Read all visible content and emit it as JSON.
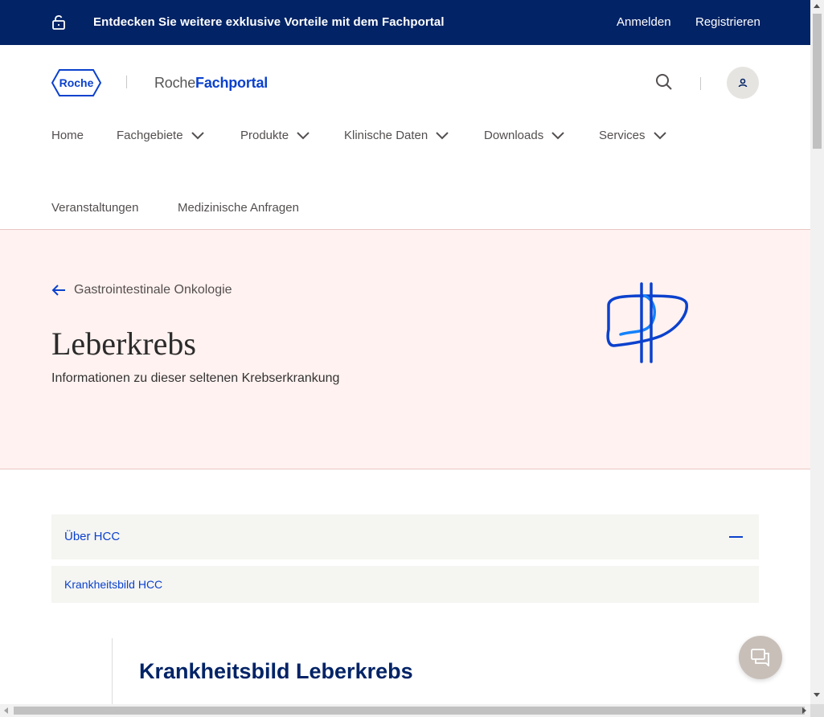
{
  "topbar": {
    "promo": "Entdecken Sie weitere exklusive Vorteile mit dem Fachportal",
    "login": "Anmelden",
    "register": "Registrieren",
    "lock_icon": "unlock-icon",
    "background": "#022366"
  },
  "header": {
    "logo_text": "Roche",
    "portal_prefix": "Roche",
    "portal_name": "Fachportal",
    "search_icon": "search-icon",
    "user_icon": "user-icon"
  },
  "nav": {
    "items": [
      {
        "label": "Home",
        "has_dropdown": false
      },
      {
        "label": "Fachgebiete",
        "has_dropdown": true
      },
      {
        "label": "Produkte",
        "has_dropdown": true
      },
      {
        "label": "Klinische Daten",
        "has_dropdown": true
      },
      {
        "label": "Downloads",
        "has_dropdown": true
      },
      {
        "label": "Services",
        "has_dropdown": true
      }
    ],
    "row2": [
      {
        "label": "Veranstaltungen"
      },
      {
        "label": "Medizinische Anfragen"
      }
    ]
  },
  "hero": {
    "breadcrumb": "Gastrointestinale Onkologie",
    "title": "Leberkrebs",
    "subtitle": "Informationen zu dieser seltenen Krebserkrankung",
    "icon": "liver-icon",
    "background": "#fff2f0"
  },
  "accordion": {
    "header": "Über HCC",
    "items": [
      "Krankheitsbild HCC"
    ]
  },
  "content": {
    "title": "Krankheitsbild Leberkrebs"
  },
  "chat": {
    "icon": "chat-icon"
  },
  "colors": {
    "brand_blue": "#0b41cd",
    "navy": "#022366"
  }
}
